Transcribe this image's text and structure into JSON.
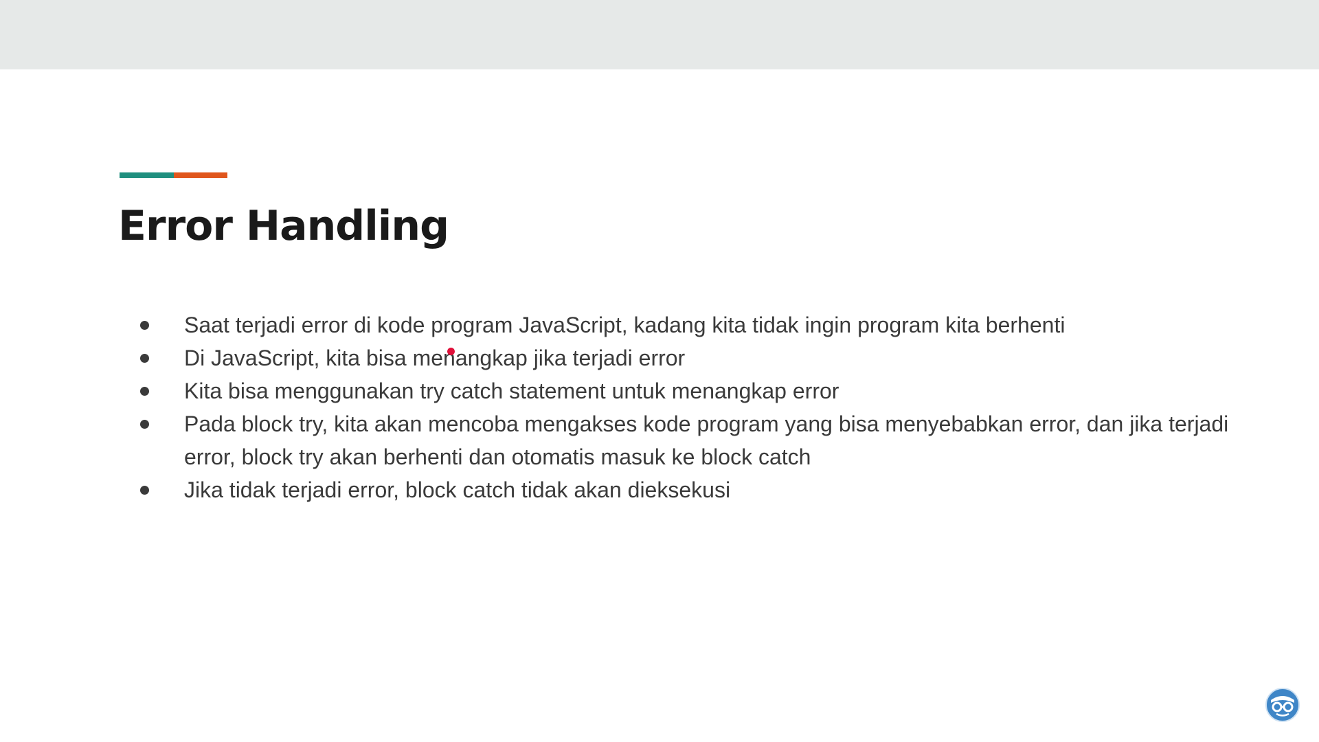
{
  "colors": {
    "accent_teal": "#1f8f7f",
    "accent_orange": "#e0561c",
    "logo_blue": "#3f86c7"
  },
  "slide": {
    "title": "Error Handling",
    "bullets": [
      "Saat terjadi error di kode program JavaScript, kadang kita tidak ingin program kita berhenti",
      "Di JavaScript, kita bisa menangkap jika terjadi error",
      "Kita bisa menggunakan try catch statement untuk menangkap error",
      "Pada block try, kita akan mencoba mengakses kode program yang bisa menyebabkan error, dan jika terjadi error, block try akan berhenti dan otomatis masuk ke block catch",
      "Jika tidak terjadi error, block catch tidak akan dieksekusi"
    ]
  },
  "icons": {
    "logo": "glasses-face-logo-icon",
    "pointer": "laser-pointer-dot"
  }
}
